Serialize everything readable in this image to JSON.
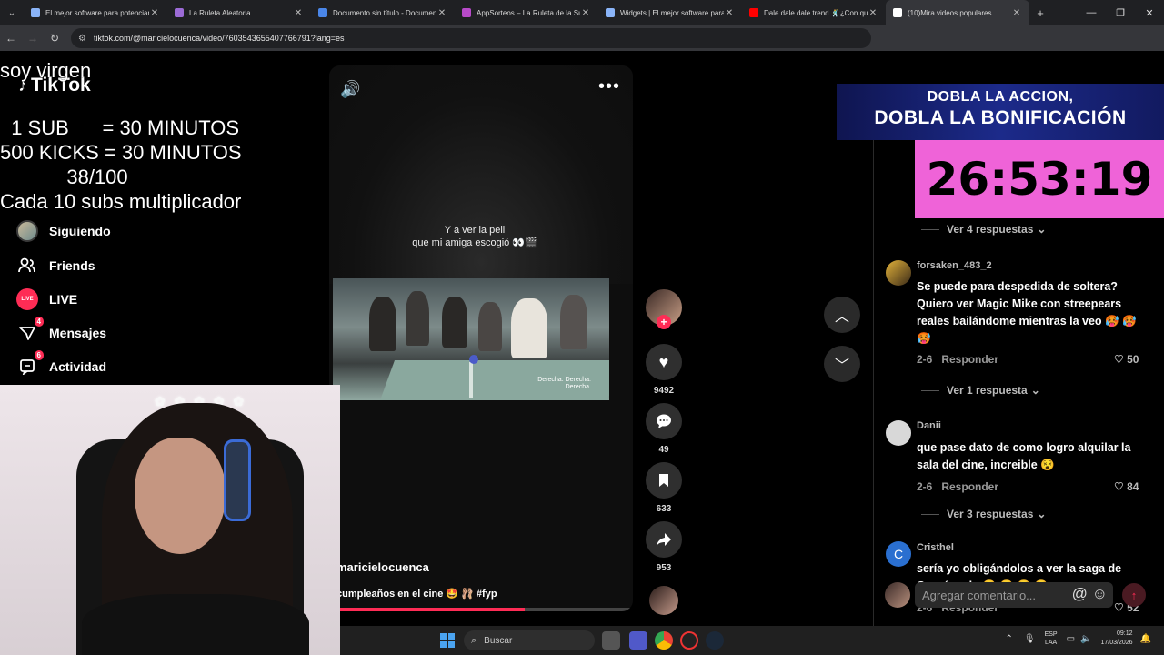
{
  "browser": {
    "tabs": [
      {
        "label": "El mejor software para potenciar",
        "color": "#8ab4f8",
        "active": false
      },
      {
        "label": "La Ruleta Aleatoria",
        "color": "#9c6bd6",
        "active": false
      },
      {
        "label": "Documento sin título - Documentos",
        "color": "#4a86e8",
        "active": false
      },
      {
        "label": "AppSorteos – La Ruleta de la Suerte",
        "color": "#b84ac9",
        "active": false
      },
      {
        "label": "Widgets | El mejor software para",
        "color": "#8ab4f8",
        "active": false
      },
      {
        "label": "Dale dale dale trend 🕺¿Con quién",
        "color": "#ff0000",
        "active": false
      },
      {
        "label": "(10)Mira videos populares",
        "color": "#ffffff",
        "active": true
      }
    ],
    "url": "tiktok.com/@maricielocuenca/video/7603543655407766791?lang=es"
  },
  "sidebar": {
    "logo_text": "TikTok",
    "items": [
      {
        "label": "Siguiendo",
        "icon": "following-avatar-icon",
        "badge": ""
      },
      {
        "label": "Friends",
        "icon": "friends-icon",
        "badge": ""
      },
      {
        "label": "LIVE",
        "icon": "live-icon",
        "badge": ""
      },
      {
        "label": "Mensajes",
        "icon": "messages-icon",
        "badge": "4"
      },
      {
        "label": "Actividad",
        "icon": "activity-icon",
        "badge": "6"
      }
    ]
  },
  "stream_overlay": {
    "line1": "soy virgen",
    "line2": "  1 SUB      = 30 MINUTOS",
    "line3": "500 KICKS = 30 MINUTOS",
    "line4": "            38/100",
    "line5": "Cada 10 subs multiplicador"
  },
  "video": {
    "caption_line1": "Y a ver la peli",
    "caption_line2": "que mi amiga escogió 👀🎬",
    "film_subtitle_1": "Derecha. Derecha.",
    "film_subtitle_2": "Derecha.",
    "author": "maricielocuenca",
    "description": "cumpleaños en el cine 🤩 🩰 #fyp",
    "progress": 0.63
  },
  "actions": {
    "likes": "9492",
    "comments": "49",
    "saves": "633",
    "shares": "953"
  },
  "promo": {
    "line1": "DOBLA LA ACCION,",
    "line2": "DOBLA LA BONIFICACIÓN",
    "timer": "26:53:19"
  },
  "comments": {
    "replies_first": "Ver 4 respuestas",
    "items": [
      {
        "user": "forsaken_483_2",
        "text": "Se puede para despedida de soltera? Quiero ver Magic Mike con streepears reales bailándome mientras la veo 🥵 🥵 🥵",
        "date": "2-6",
        "reply": "Responder",
        "likes": "50",
        "more": "Ver 1 respuesta"
      },
      {
        "user": "Danii",
        "text": "que pase dato de como logro alquilar la sala del cine, increible 😵",
        "date": "2-6",
        "reply": "Responder",
        "likes": "84",
        "more": "Ver 3 respuestas"
      },
      {
        "user": "Cristhel",
        "text": "sería yo obligándolos a ver la saga de Crepúsculo 😏 😏 😂 😂",
        "date": "2-6",
        "reply": "Responder",
        "likes": "52",
        "more": ""
      }
    ],
    "input_placeholder": "Agregar comentario..."
  },
  "taskbar": {
    "search_label": "Buscar",
    "lang_line1": "ESP",
    "lang_line2": "LAA",
    "time": "09:12",
    "date": "17/03/2026"
  }
}
